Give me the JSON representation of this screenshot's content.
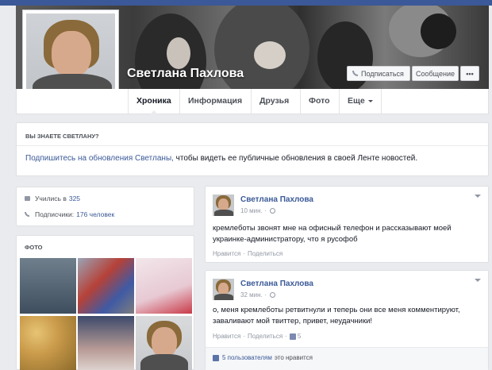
{
  "profile": {
    "name": "Светлана Пахлова"
  },
  "header_buttons": {
    "subscribe": "Подписаться",
    "message": "Сообщение",
    "more": "•••"
  },
  "tabs": [
    {
      "label": "Хроника"
    },
    {
      "label": "Информация"
    },
    {
      "label": "Друзья"
    },
    {
      "label": "Фото"
    },
    {
      "label": "Еще"
    }
  ],
  "know_card": {
    "title": "ВЫ ЗНАЕТЕ СВЕТЛАНУ?",
    "link": "Подпишитесь на обновления Светланы,",
    "text": " чтобы видеть ее публичные обновления в своей Ленте новостей."
  },
  "info": {
    "study_prefix": "Учились в",
    "study_link": "325",
    "followers_prefix": "Подписчики:",
    "followers_link": "176 человек"
  },
  "photos": {
    "title": "ФОТО"
  },
  "posts": [
    {
      "author": "Светлана Пахлова",
      "time": "10 мин. ·",
      "text": "кремлеботы звонят мне на офисный телефон и рассказывают моей украинке-администратору, что я русофоб",
      "like": "Нравится",
      "dot": "·",
      "share": "Поделиться"
    },
    {
      "author": "Светлана Пахлова",
      "time": "32 мин. ·",
      "text": "о, меня кремлеботы ретвитнули и теперь они все меня комментируют, заваливают мой твиттер, привет, неудачники!",
      "like": "Нравится",
      "dot": "·",
      "share": "Поделиться",
      "like_count": "5",
      "likes_link": "5 пользователям",
      "likes_suffix": "это нравится"
    }
  ],
  "colors": {
    "brand": "#3b5998",
    "background": "#e9ebee",
    "muted": "#9197a3"
  }
}
